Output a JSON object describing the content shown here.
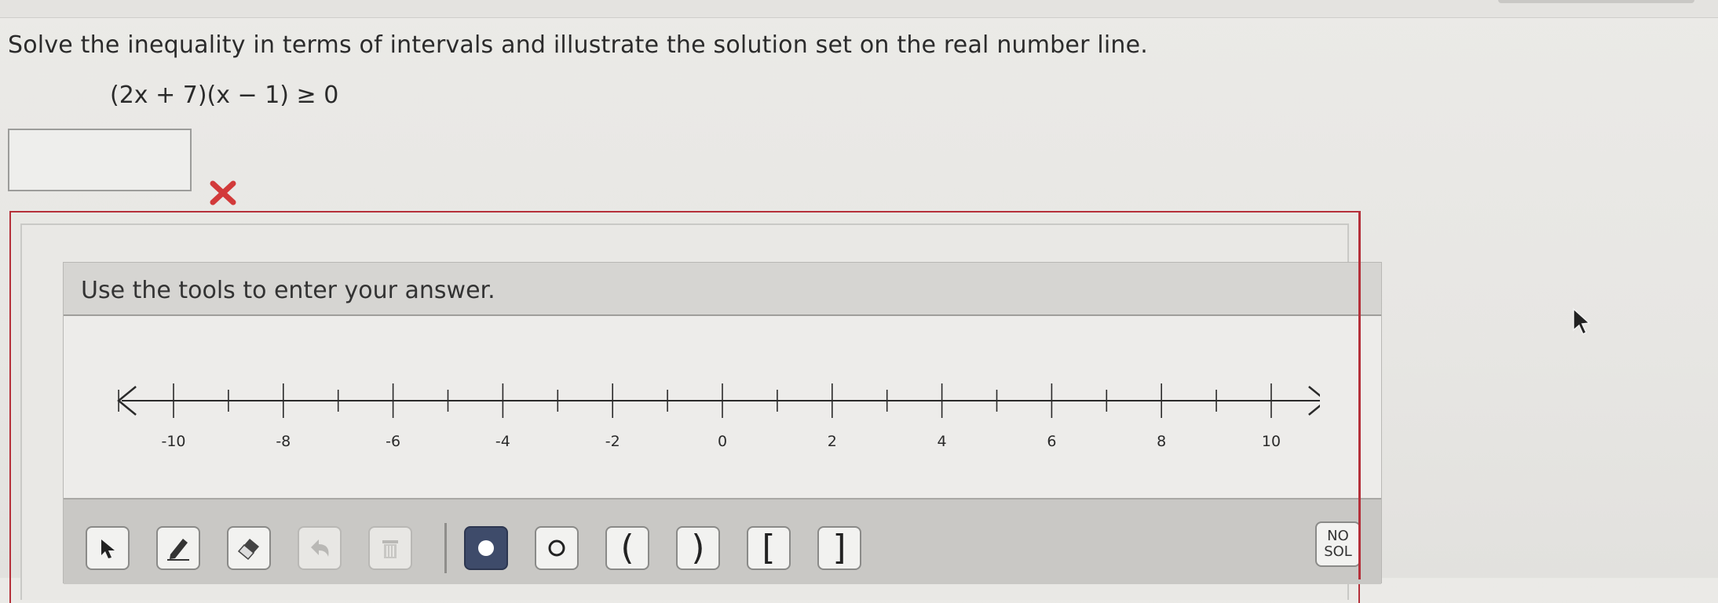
{
  "question": {
    "prompt": "Solve the inequality in terms of intervals and illustrate the solution set on the real number line.",
    "expression": "(2x + 7)(x − 1) ≥ 0"
  },
  "answer": {
    "value": "",
    "status_icon": "x-mark-icon",
    "status_color": "#d23a3a"
  },
  "panel": {
    "title": "Use the tools to enter your answer."
  },
  "number_line": {
    "min": -11,
    "max": 11,
    "labels": [
      "-10",
      "-8",
      "-6",
      "-4",
      "-2",
      "0",
      "2",
      "4",
      "6",
      "8",
      "10"
    ]
  },
  "toolbar": {
    "tools": [
      {
        "name": "pointer-tool",
        "icon": "arrow-cursor-icon",
        "enabled": true
      },
      {
        "name": "pencil-tool",
        "icon": "pencil-icon",
        "enabled": true
      },
      {
        "name": "eraser-tool",
        "icon": "eraser-icon",
        "enabled": true
      },
      {
        "name": "undo-tool",
        "icon": "undo-icon",
        "enabled": false
      },
      {
        "name": "delete-tool",
        "icon": "trash-icon",
        "enabled": false
      },
      {
        "name": "closed-dot-tool",
        "icon": "filled-circle-icon",
        "enabled": true
      },
      {
        "name": "open-dot-tool",
        "icon": "open-circle-icon",
        "enabled": true
      },
      {
        "name": "left-paren-tool",
        "label": "(",
        "enabled": true
      },
      {
        "name": "right-paren-tool",
        "label": ")",
        "enabled": true
      },
      {
        "name": "left-bracket-tool",
        "label": "[",
        "enabled": true
      },
      {
        "name": "right-bracket-tool",
        "label": "]",
        "enabled": true
      }
    ],
    "nosol_line1": "NO",
    "nosol_line2": "SOL"
  },
  "colors": {
    "frame_red": "#b5303a",
    "active_tool": "#3e4b6a"
  }
}
